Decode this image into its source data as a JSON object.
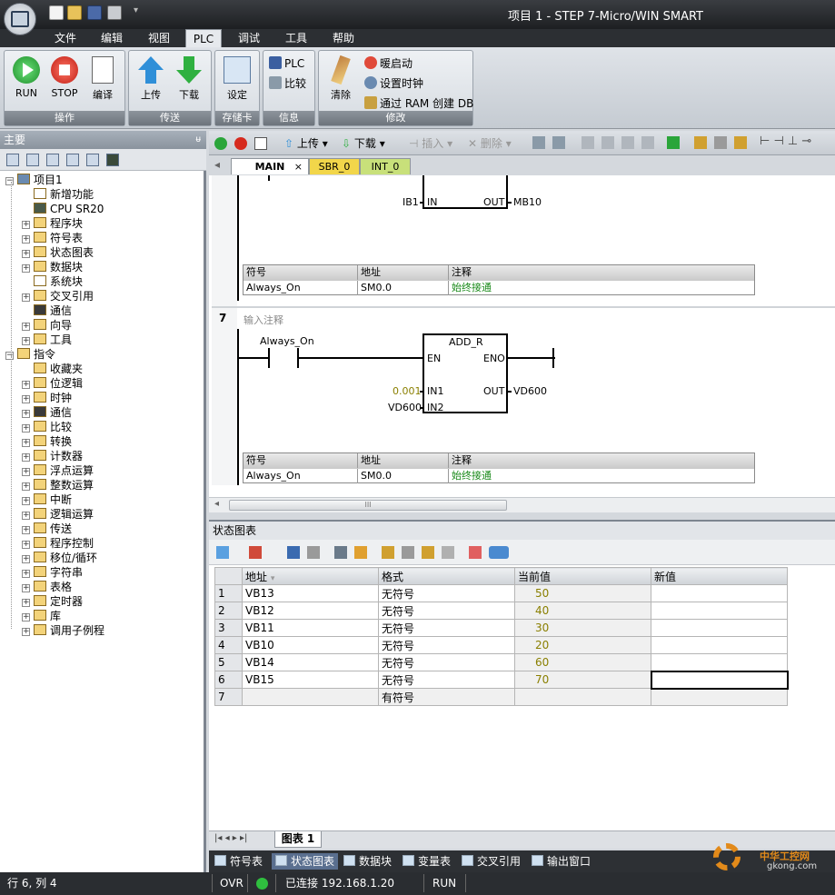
{
  "window": {
    "title": "项目 1 - STEP 7-Micro/WIN SMART"
  },
  "ribbon_tabs": [
    "文件",
    "编辑",
    "视图",
    "PLC",
    "调试",
    "工具",
    "帮助"
  ],
  "ribbon_groups": {
    "operation": {
      "label": "操作",
      "run": "RUN",
      "stop": "STOP",
      "compile": "编译"
    },
    "transfer": {
      "label": "传送",
      "upload": "上传",
      "download": "下载"
    },
    "memcard": {
      "label": "存储卡",
      "setup": "设定"
    },
    "info": {
      "label": "信息",
      "plc": "PLC",
      "compare": "比较"
    },
    "modify": {
      "label": "修改",
      "clear": "清除",
      "warm_start": "暖启动",
      "set_clock": "设置时钟",
      "ram_db": "通过 RAM 创建 DB"
    }
  },
  "left_panel": {
    "header": "主要",
    "pin": "ᵾ",
    "tree": [
      {
        "label": "项目1",
        "level": 0,
        "expander": "−"
      },
      {
        "label": "新增功能",
        "level": 1,
        "expander": ""
      },
      {
        "label": "CPU SR20",
        "level": 1,
        "expander": ""
      },
      {
        "label": "程序块",
        "level": 1,
        "expander": "+"
      },
      {
        "label": "符号表",
        "level": 1,
        "expander": "+"
      },
      {
        "label": "状态图表",
        "level": 1,
        "expander": "+"
      },
      {
        "label": "数据块",
        "level": 1,
        "expander": "+"
      },
      {
        "label": "系统块",
        "level": 1,
        "expander": ""
      },
      {
        "label": "交叉引用",
        "level": 1,
        "expander": "+"
      },
      {
        "label": "通信",
        "level": 1,
        "expander": ""
      },
      {
        "label": "向导",
        "level": 1,
        "expander": "+"
      },
      {
        "label": "工具",
        "level": 1,
        "expander": "+"
      },
      {
        "label": "指令",
        "level": 0,
        "expander": "−"
      },
      {
        "label": "收藏夹",
        "level": 1,
        "expander": ""
      },
      {
        "label": "位逻辑",
        "level": 1,
        "expander": "+"
      },
      {
        "label": "时钟",
        "level": 1,
        "expander": "+"
      },
      {
        "label": "通信",
        "level": 1,
        "expander": "+"
      },
      {
        "label": "比较",
        "level": 1,
        "expander": "+"
      },
      {
        "label": "转换",
        "level": 1,
        "expander": "+"
      },
      {
        "label": "计数器",
        "level": 1,
        "expander": "+"
      },
      {
        "label": "浮点运算",
        "level": 1,
        "expander": "+"
      },
      {
        "label": "整数运算",
        "level": 1,
        "expander": "+"
      },
      {
        "label": "中断",
        "level": 1,
        "expander": "+"
      },
      {
        "label": "逻辑运算",
        "level": 1,
        "expander": "+"
      },
      {
        "label": "传送",
        "level": 1,
        "expander": "+"
      },
      {
        "label": "程序控制",
        "level": 1,
        "expander": "+"
      },
      {
        "label": "移位/循环",
        "level": 1,
        "expander": "+"
      },
      {
        "label": "字符串",
        "level": 1,
        "expander": "+"
      },
      {
        "label": "表格",
        "level": 1,
        "expander": "+"
      },
      {
        "label": "定时器",
        "level": 1,
        "expander": "+"
      },
      {
        "label": "库",
        "level": 1,
        "expander": "+"
      },
      {
        "label": "调用子例程",
        "level": 1,
        "expander": "+"
      }
    ]
  },
  "editor_toolbar": {
    "upload": "上传",
    "download": "下载",
    "insert": "插入",
    "delete": "删除"
  },
  "editor_tabs": [
    "MAIN",
    "SBR_0",
    "INT_0"
  ],
  "editor_tab_close": "×",
  "editor_scroll_left": "◂",
  "network6": {
    "in_addr": "IB1",
    "in_pin": "IN",
    "out_pin": "OUT",
    "out_addr": "MB10",
    "symbols": {
      "headers": [
        "符号",
        "地址",
        "注释"
      ],
      "row": [
        "Always_On",
        "SM0.0",
        "始终接通"
      ]
    }
  },
  "network7": {
    "number": "7",
    "comment": "输入注释",
    "contact": "Always_On",
    "block": "ADD_R",
    "en": "EN",
    "eno": "ENO",
    "in1_val": "0.001",
    "in1": "IN1",
    "in2_addr": "VD600",
    "in2": "IN2",
    "out": "OUT",
    "out_addr": "VD600",
    "symbols": {
      "headers": [
        "符号",
        "地址",
        "注释"
      ],
      "row": [
        "Always_On",
        "SM0.0",
        "始终接通"
      ]
    }
  },
  "hscroll_grip": "III",
  "status_chart": {
    "title": "状态图表",
    "headers": [
      "地址",
      "格式",
      "当前值",
      "新值"
    ],
    "rows": [
      {
        "n": "1",
        "addr": "VB13",
        "fmt": "无符号",
        "cur": "50",
        "new": ""
      },
      {
        "n": "2",
        "addr": "VB12",
        "fmt": "无符号",
        "cur": "40",
        "new": ""
      },
      {
        "n": "3",
        "addr": "VB11",
        "fmt": "无符号",
        "cur": "30",
        "new": ""
      },
      {
        "n": "4",
        "addr": "VB10",
        "fmt": "无符号",
        "cur": "20",
        "new": ""
      },
      {
        "n": "5",
        "addr": "VB14",
        "fmt": "无符号",
        "cur": "60",
        "new": ""
      },
      {
        "n": "6",
        "addr": "VB15",
        "fmt": "无符号",
        "cur": "70",
        "new": ""
      },
      {
        "n": "7",
        "addr": "",
        "fmt": "有符号",
        "cur": "",
        "new": ""
      }
    ],
    "sheet_tab": "图表  1",
    "nav": "|◂  ◂  ▸  ▸|"
  },
  "bottom_tabs": [
    "符号表",
    "状态图表",
    "数据块",
    "变量表",
    "交叉引用",
    "输出窗口"
  ],
  "status_bar": {
    "position": "行 6, 列 4",
    "mode": "OVR",
    "connection": "已连接 192.168.1.20",
    "state": "RUN"
  },
  "watermark": {
    "line1": "中华工控网",
    "line2": "gkong.com"
  },
  "colors": {
    "accent": "#2c2f33",
    "run_green": "#27a635",
    "stop_red": "#d62a1e",
    "value_olive": "#8a7f00",
    "comment_green": "#1a8a1a"
  }
}
